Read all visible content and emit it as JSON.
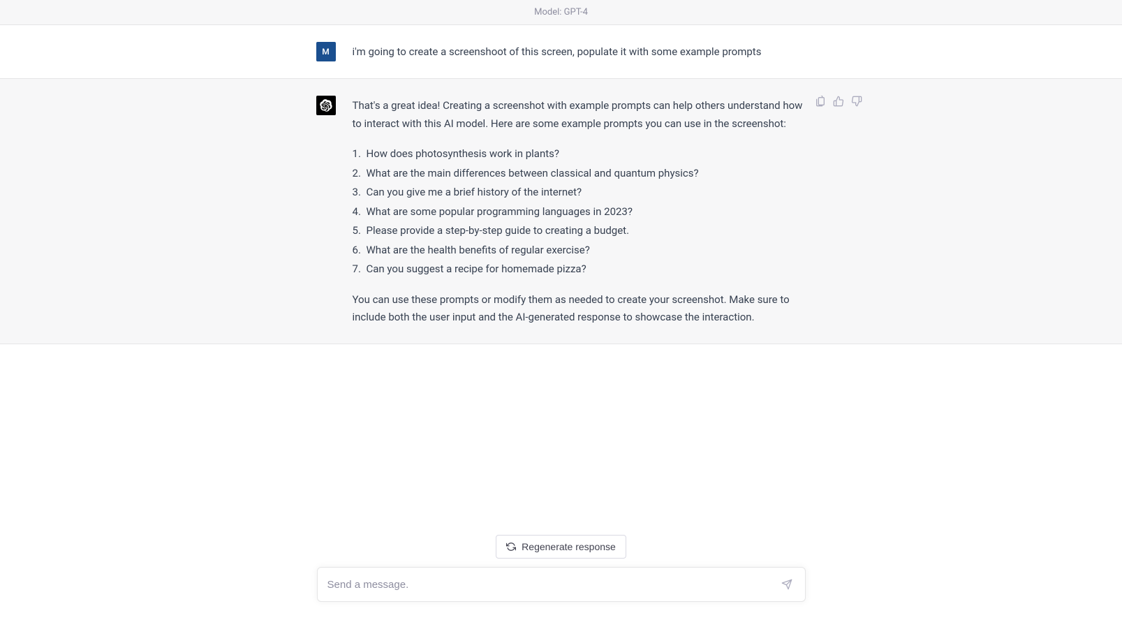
{
  "header": {
    "model_label": "Model: GPT-4"
  },
  "user": {
    "avatar_letter": "M",
    "message": "i'm going to create a screenshoot of this screen, populate it with some example prompts"
  },
  "assistant": {
    "intro": "That's a great idea! Creating a screenshot with example prompts can help others understand how to interact with this AI model. Here are some example prompts you can use in the screenshot:",
    "prompts": [
      "How does photosynthesis work in plants?",
      "What are the main differences between classical and quantum physics?",
      "Can you give me a brief history of the internet?",
      "What are some popular programming languages in 2023?",
      "Please provide a step-by-step guide to creating a budget.",
      "What are the health benefits of regular exercise?",
      "Can you suggest a recipe for homemade pizza?"
    ],
    "outro": "You can use these prompts or modify them as needed to create your screenshot. Make sure to include both the user input and the AI-generated response to showcase the interaction."
  },
  "footer": {
    "regenerate_label": "Regenerate response",
    "input_placeholder": "Send a message."
  }
}
